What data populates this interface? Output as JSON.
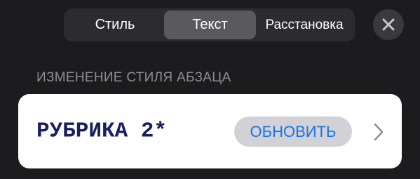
{
  "tabs": [
    {
      "label": "Стиль",
      "selected": false
    },
    {
      "label": "Текст",
      "selected": true
    },
    {
      "label": "Расстановка",
      "selected": false
    }
  ],
  "close_icon": "close-icon",
  "section_header": "ИЗМЕНЕНИЕ СТИЛЯ АБЗАЦА",
  "paragraph_style": {
    "name": "РУБРИКА 2*",
    "update_label": "ОБНОВИТЬ",
    "chevron_icon": "chevron-right-icon"
  },
  "colors": {
    "background": "#1c1c1e",
    "accent": "#1a73e8",
    "style_name": "#1a1f5e"
  }
}
